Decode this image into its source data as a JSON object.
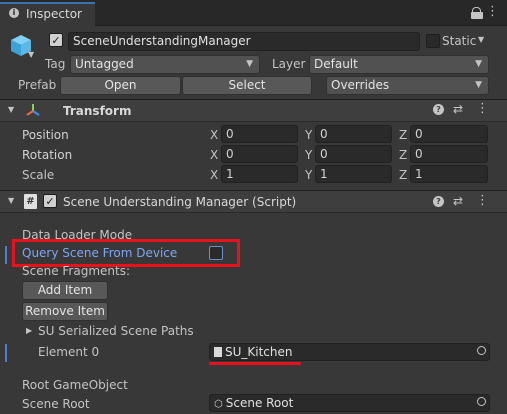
{
  "window": {
    "tab_title": "Inspector"
  },
  "object": {
    "name": "SceneUnderstandingManager",
    "static_label": "Static",
    "tag_label": "Tag",
    "tag_value": "Untagged",
    "layer_label": "Layer",
    "layer_value": "Default",
    "prefab_label": "Prefab",
    "open_label": "Open",
    "select_label": "Select",
    "overrides_label": "Overrides"
  },
  "transform": {
    "title": "Transform",
    "rows": [
      {
        "label": "Position",
        "x": "0",
        "y": "0",
        "z": "0"
      },
      {
        "label": "Rotation",
        "x": "0",
        "y": "0",
        "z": "0"
      },
      {
        "label": "Scale",
        "x": "1",
        "y": "1",
        "z": "1"
      }
    ],
    "axis_x": "X",
    "axis_y": "Y",
    "axis_z": "Z"
  },
  "script": {
    "title": "Scene Understanding Manager (Script)",
    "data_loader_mode": "Data Loader Mode",
    "query_scene": "Query Scene From Device",
    "scene_fragments": "Scene Fragments:",
    "add_item": "Add Item",
    "remove_item": "Remove Item",
    "su_paths": "SU Serialized Scene Paths",
    "element0_label": "Element 0",
    "element0_value": "SU_Kitchen",
    "root_gameobject": "Root GameObject",
    "scene_root_label": "Scene Root",
    "scene_root_value": "Scene Root"
  },
  "colors": {
    "highlight_red": "#e8111c",
    "label_blue": "#7ba7f5",
    "background": "#383838"
  }
}
